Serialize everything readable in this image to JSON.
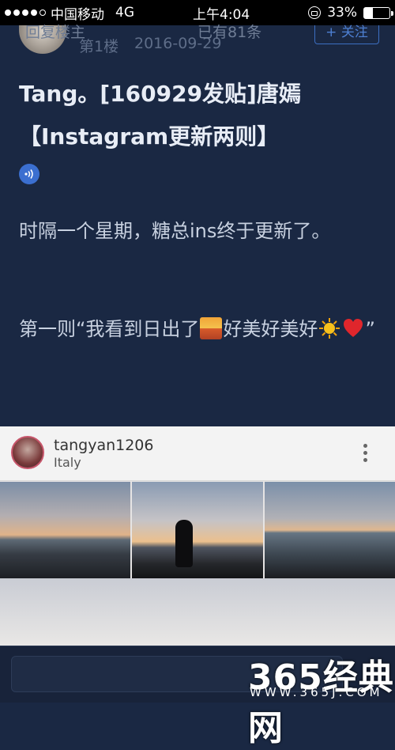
{
  "status_bar": {
    "carrier": "中国移动",
    "network": "4G",
    "time": "上午4:04",
    "battery": "33%",
    "battery_level": 0.33
  },
  "post": {
    "floor": "第1楼",
    "date": "2016-09-29",
    "follow_label": "+ 关注",
    "title": "Tang。[160929发贴]唐嫣【Instagram更新两则】",
    "paragraph1": "时隔一个星期，糖总ins终于更新了。",
    "paragraph2_a": "第一则“我看到日出了",
    "paragraph2_b": "好美好美好",
    "paragraph2_c": "”"
  },
  "instagram": {
    "username": "tangyan1206",
    "location": "Italy"
  },
  "reply_bar": {
    "placeholder": "回复楼主",
    "count_text": "已有81条"
  },
  "watermark": {
    "text": "365经典网",
    "url": "WWW.365J.COM"
  },
  "colors": {
    "background": "#1a2843",
    "accent": "#3c6fc2"
  }
}
